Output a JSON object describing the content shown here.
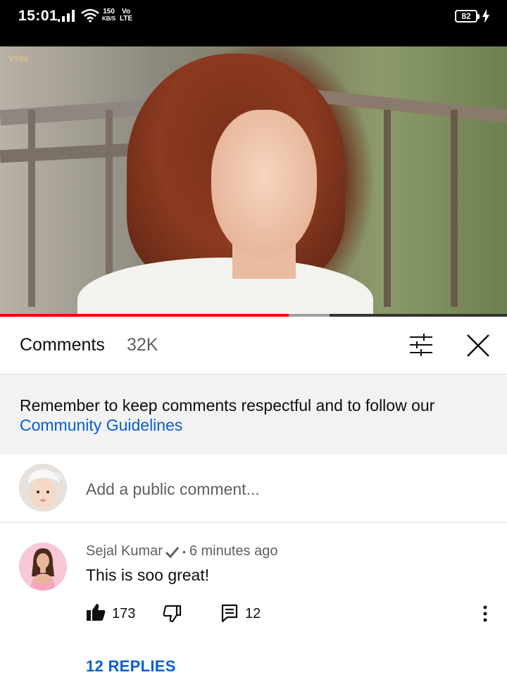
{
  "status_bar": {
    "time": "15:01",
    "net_speed_value": "150",
    "net_speed_unit": "KB/S",
    "volte_top": "Vo",
    "volte_bottom": "LTE",
    "battery": "82"
  },
  "video": {
    "watermark": "VYRL",
    "progress_played": 0.57,
    "progress_buffered": 0.65
  },
  "comments": {
    "title": "Comments",
    "count": "32K",
    "banner_text": "Remember to keep comments respectful and to follow our",
    "banner_link": "Community Guidelines",
    "input_placeholder": "Add a public comment..."
  },
  "thread": {
    "author": "Sejal Kumar",
    "separator": "•",
    "time": "6 minutes ago",
    "text": "This is soo great!",
    "likes": "173",
    "replies_count": "12",
    "replies_link": "12 REPLIES"
  },
  "colors": {
    "accent_link": "#065fd4",
    "progress_red": "#ff0000"
  },
  "icons": [
    "signal-icon",
    "wifi-icon",
    "charge-icon",
    "sort-icon",
    "close-icon",
    "verified-icon",
    "like-icon",
    "dislike-icon",
    "reply-icon",
    "more-icon"
  ]
}
